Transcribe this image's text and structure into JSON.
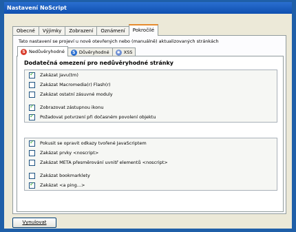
{
  "window": {
    "title": "Nastavení NoScript"
  },
  "tabs": [
    {
      "label": "Obecné",
      "active": false
    },
    {
      "label": "Výjimky",
      "active": false
    },
    {
      "label": "Zobrazení",
      "active": false
    },
    {
      "label": "Oznámení",
      "active": false
    },
    {
      "label": "Pokročilé",
      "active": true
    }
  ],
  "intro": "Tato nastavení se projeví u nově otevřených nebo (manuálně) aktualizovaných stránkách",
  "subtabs": [
    {
      "label": "Nedůvěryhodné",
      "icon": "untrusted-icon",
      "active": true
    },
    {
      "label": "Důvěryhodné",
      "icon": "trusted-icon",
      "active": false
    },
    {
      "label": "XSS",
      "icon": "xss-icon",
      "active": false
    }
  ],
  "heading": "Dodatečná omezení pro nedůvěryhodné stránky",
  "group1": [
    {
      "label": "Zakázat Javu(tm)",
      "checked": true
    },
    {
      "label": "Zakázat Macromedia(r) Flash(r)",
      "checked": false
    },
    {
      "label": "Zakázat ostatní zásuvné moduly",
      "checked": false
    },
    {
      "label": "Zobrazovat zástupnou ikonu",
      "checked": true
    },
    {
      "label": "Požadovat potvrzení při dočasném povolení objektu",
      "checked": true
    }
  ],
  "group2": [
    {
      "label": "Pokusit se opravit odkazy tvořené JavaScriptem",
      "checked": true
    },
    {
      "label": "Zakázat prvky <noscript>",
      "checked": false
    },
    {
      "label": "Zakázat META přesměrování uvnitř elementů <noscript>",
      "checked": false
    },
    {
      "label": "Zakázat bookmarklety",
      "checked": false
    },
    {
      "label": "Zakázat <a ping...>",
      "checked": true
    }
  ],
  "footer": {
    "reset_label": "Vynulovat"
  }
}
